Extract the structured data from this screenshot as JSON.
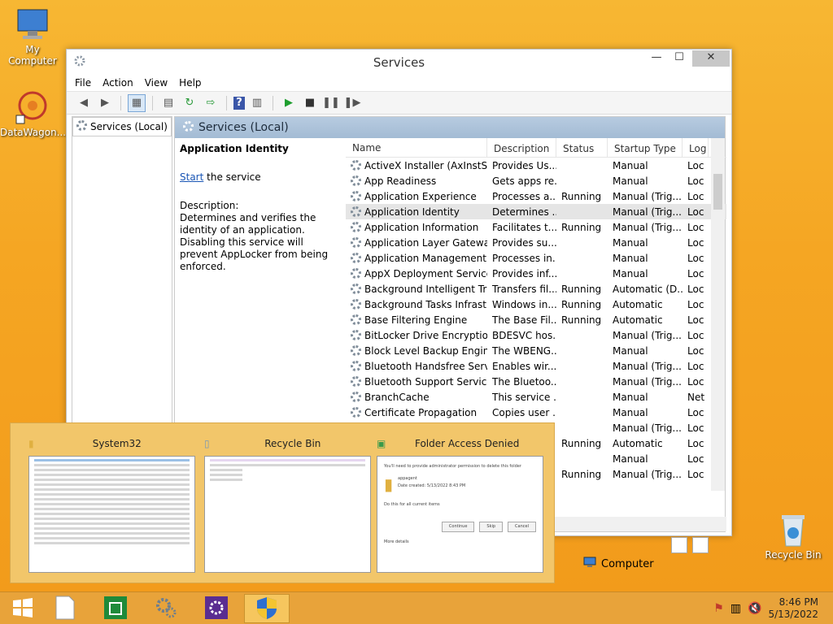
{
  "desktop": {
    "icons": [
      {
        "label": "My Computer"
      },
      {
        "label": "DataWagon..."
      },
      {
        "label": "Recycle Bin"
      }
    ]
  },
  "window": {
    "title": "Services",
    "controls": {
      "minimize": "—",
      "maximize": "☐",
      "close": "✕"
    },
    "menu": [
      "File",
      "Action",
      "View",
      "Help"
    ],
    "tree_item": "Services (Local)",
    "pane_header": "Services (Local)",
    "selected_service": "Application Identity",
    "start_link": "Start",
    "start_rest": " the service",
    "description_label": "Description:",
    "description": "Determines and verifies the identity of an application. Disabling this service will prevent AppLocker from being enforced.",
    "columns": [
      "Name",
      "Description",
      "Status",
      "Startup Type",
      "Log"
    ],
    "rows": [
      [
        "ActiveX Installer (AxInstSV)",
        "Provides Us...",
        "",
        "Manual",
        "Loc"
      ],
      [
        "App Readiness",
        "Gets apps re...",
        "",
        "Manual",
        "Loc"
      ],
      [
        "Application Experience",
        "Processes a...",
        "Running",
        "Manual (Trig...",
        "Loc"
      ],
      [
        "Application Identity",
        "Determines ...",
        "",
        "Manual (Trig...",
        "Loc"
      ],
      [
        "Application Information",
        "Facilitates t...",
        "Running",
        "Manual (Trig...",
        "Loc"
      ],
      [
        "Application Layer Gateway ...",
        "Provides su...",
        "",
        "Manual",
        "Loc"
      ],
      [
        "Application Management",
        "Processes in...",
        "",
        "Manual",
        "Loc"
      ],
      [
        "AppX Deployment Service (...",
        "Provides inf...",
        "",
        "Manual",
        "Loc"
      ],
      [
        "Background Intelligent Tran...",
        "Transfers fil...",
        "Running",
        "Automatic (D...",
        "Loc"
      ],
      [
        "Background Tasks Infrastru...",
        "Windows in...",
        "Running",
        "Automatic",
        "Loc"
      ],
      [
        "Base Filtering Engine",
        "The Base Fil...",
        "Running",
        "Automatic",
        "Loc"
      ],
      [
        "BitLocker Drive Encryption ...",
        "BDESVC hos...",
        "",
        "Manual (Trig...",
        "Loc"
      ],
      [
        "Block Level Backup Engine ...",
        "The WBENG...",
        "",
        "Manual",
        "Loc"
      ],
      [
        "Bluetooth Handsfree Service",
        "Enables wir...",
        "",
        "Manual (Trig...",
        "Loc"
      ],
      [
        "Bluetooth Support Service",
        "The Bluetoo...",
        "",
        "Manual (Trig...",
        "Loc"
      ],
      [
        "BranchCache",
        "This service ...",
        "",
        "Manual",
        "Net"
      ],
      [
        "Certificate Propagation",
        "Copies user ...",
        "",
        "Manual",
        "Loc"
      ],
      [
        "",
        "",
        "",
        "Manual (Trig...",
        "Loc"
      ],
      [
        "",
        "",
        "Running",
        "Automatic",
        "Loc"
      ],
      [
        "",
        "",
        "",
        "Manual",
        "Loc"
      ],
      [
        "",
        "",
        "Running",
        "Manual (Trig...",
        "Loc"
      ]
    ],
    "selected_row_index": 3,
    "status_tab": "Computer"
  },
  "peek": {
    "items": [
      {
        "title": "System32"
      },
      {
        "title": "Recycle Bin"
      },
      {
        "title": "Folder Access Denied"
      }
    ],
    "dialog": {
      "line1": "You'll need to provide administrator permission to delete this folder",
      "folder": "appagent",
      "date": "Date created: 5/13/2022 8:43 PM",
      "checkbox": "Do this for all current items",
      "continue": "Continue",
      "skip": "Skip",
      "cancel": "Cancel",
      "more": "More details"
    }
  },
  "taskbar": {
    "time": "8:46 PM",
    "date": "5/13/2022"
  }
}
